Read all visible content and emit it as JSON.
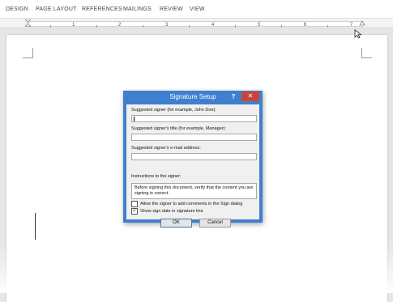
{
  "ribbon": {
    "tabs": [
      "DESIGN",
      "PAGE LAYOUT",
      "REFERENCES",
      "MAILINGS",
      "REVIEW",
      "VIEW"
    ]
  },
  "ruler": {
    "numbers": [
      "1",
      "2",
      "3",
      "4",
      "5",
      "6",
      "7"
    ]
  },
  "dialog": {
    "title": "Signature Setup",
    "help_glyph": "?",
    "close_glyph": "✕",
    "suggested_signer_label": "Suggested signer (for example, John Doe):",
    "suggested_signer_value": "",
    "signer_title_label": "Suggested signer's title (for example, Manager):",
    "signer_title_value": "",
    "signer_email_label": "Suggested signer's e-mail address:",
    "signer_email_value": "",
    "instructions_label": "Instructions to the signer:",
    "instructions_value": "Before signing this document, verify that the content you are signing is correct.",
    "allow_comments_label": "Allow the signer to add comments in the Sign dialog",
    "allow_comments_checked": false,
    "show_date_label": "Show sign date in signature line",
    "show_date_checked": true,
    "ok_label": "OK",
    "cancel_label": "Cancel",
    "check_glyph": "✓"
  },
  "colors": {
    "dialog_frame": "#3f7fcf",
    "close_button": "#c7463b",
    "page_background": "#ffffff"
  },
  "icons": {
    "cursor": "mouse-pointer-icon",
    "indent": "indent-marker-icon"
  }
}
